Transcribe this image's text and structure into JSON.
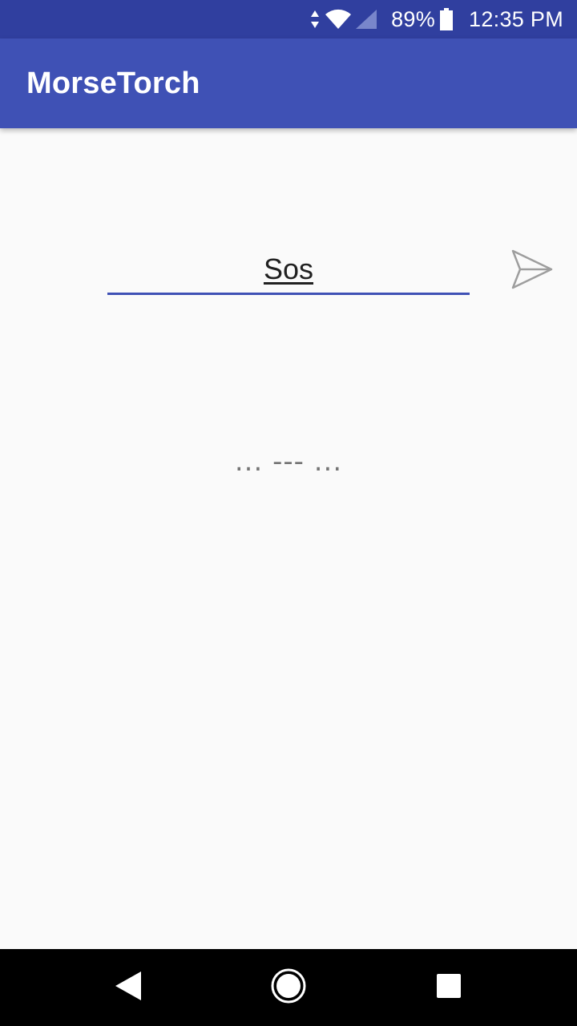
{
  "status_bar": {
    "battery_percent": "89%",
    "time": "12:35 PM",
    "icons": [
      "data-arrows-icon",
      "wifi-icon",
      "cell-signal-icon",
      "battery-icon"
    ]
  },
  "app_bar": {
    "title": "MorseTorch"
  },
  "message_input": {
    "value": "Sos"
  },
  "send_button": {
    "icon": "send-icon"
  },
  "morse_output": {
    "text": "... --- ..."
  },
  "navigation_bar": {
    "icons": [
      "back-icon",
      "home-icon",
      "recents-icon"
    ]
  },
  "colors": {
    "status_bar": "#303f9f",
    "app_bar": "#3f51b5",
    "accent_underline": "#3f51b5",
    "background": "#fafafa",
    "morse_text": "#757575",
    "nav_bar": "#000000"
  }
}
